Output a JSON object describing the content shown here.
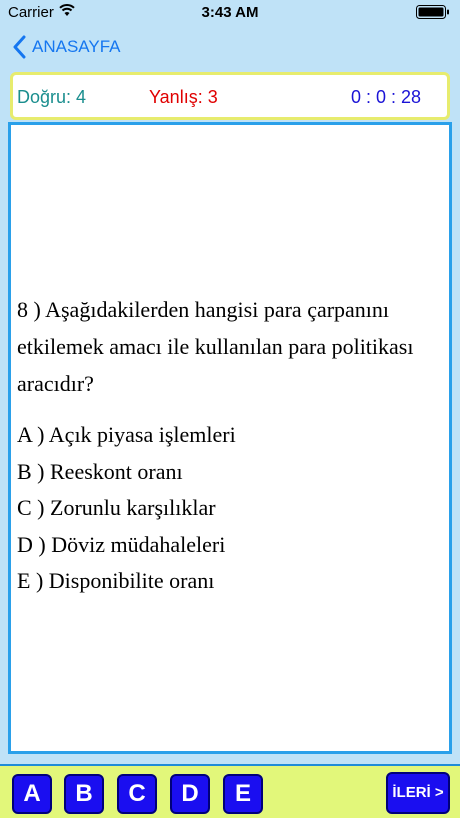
{
  "status_bar": {
    "carrier": "Carrier",
    "time": "3:43 AM"
  },
  "nav": {
    "back_label": "ANASAYFA"
  },
  "score": {
    "correct": "Doğru: 4",
    "wrong": "Yanlış: 3",
    "timer": "0 : 0 : 28"
  },
  "question": {
    "text": "8 ) Aşağıdakilerden hangisi para çarpanını etkilemek amacı ile kullanılan para politikası aracıdır?",
    "options": [
      "A ) Açık piyasa işlemleri",
      "B ) Reeskont oranı",
      "C ) Zorunlu karşılıklar",
      "D ) Döviz müdahaleleri",
      "E ) Disponibilite oranı"
    ]
  },
  "answers": {
    "a": "A",
    "b": "B",
    "c": "C",
    "d": "D",
    "e": "E",
    "next": "İLERİ >"
  },
  "colors": {
    "background": "#bfe2f7",
    "back_link": "#1576f0",
    "correct": "#1a8e8e",
    "wrong": "#e00000",
    "timer": "#1b13d6",
    "panel_border": "#2aa0ea",
    "answer_bar": "#e2f77a",
    "answer_button": "#1a0ef0"
  }
}
